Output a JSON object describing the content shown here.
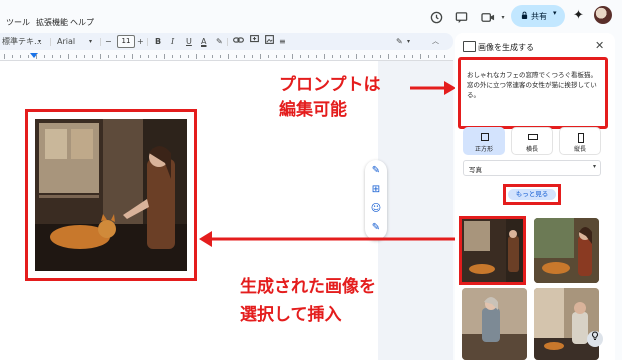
{
  "menu": {
    "items": [
      "ツール",
      "拡張機能",
      "ヘルプ"
    ]
  },
  "header": {
    "share_label": "共有"
  },
  "toolbar": {
    "style_label": "標準テキ…",
    "font_label": "Arial",
    "font_size": "11",
    "minus": "−",
    "plus": "+",
    "bold": "B",
    "italic": "I",
    "underline": "U",
    "text_color": "A"
  },
  "annotations": {
    "prompt_line1": "プロンプトは",
    "prompt_line2": "編集可能",
    "generated_line1": "生成された画像を",
    "generated_line2": "選択して挿入",
    "color": "#e41d1d"
  },
  "side_panel": {
    "title": "画像を生成する",
    "prompt_text": "おしゃれなカフェの窓際でくつろぐ看板猫。窓の外に立つ常連客の女性が猫に挨拶している。",
    "shapes": [
      {
        "label": "正方形",
        "selected": true
      },
      {
        "label": "横長",
        "selected": false
      },
      {
        "label": "縦長",
        "selected": false
      }
    ],
    "style_value": "写真",
    "more_button": "もっと見る"
  },
  "icons": [
    "history-icon",
    "comment-icon",
    "video-icon",
    "lock-icon",
    "sparkle-icon",
    "pencil-icon",
    "close-icon",
    "help-icon"
  ],
  "colors": {
    "share_bg": "#c2e7ff",
    "selected_shape_bg": "#d3e3fd",
    "accent": "#0b57d0"
  }
}
